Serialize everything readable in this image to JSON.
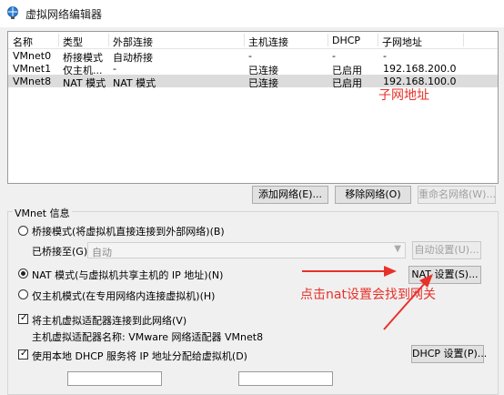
{
  "window": {
    "title": "虚拟网络编辑器"
  },
  "table": {
    "columns": [
      "名称",
      "类型",
      "外部连接",
      "主机连接",
      "DHCP",
      "子网地址"
    ],
    "rows": [
      [
        "VMnet0",
        "桥接模式",
        "自动桥接",
        "-",
        "-",
        "-"
      ],
      [
        "VMnet1",
        "仅主机...",
        "-",
        "已连接",
        "已启用",
        "192.168.200.0"
      ],
      [
        "VMnet8",
        "NAT 模式",
        "NAT 模式",
        "已连接",
        "已启用",
        "192.168.100.0"
      ]
    ],
    "selected_row": 2
  },
  "buttons": {
    "add_network": "添加网络(E)...",
    "remove_network": "移除网络(O)",
    "rename_network": "重命名网络(W)...",
    "auto_settings": "自动设置(U)...",
    "nat_settings": "NAT 设置(S)...",
    "dhcp_settings": "DHCP 设置(P)..."
  },
  "vmnet_info": {
    "group_label": "VMnet 信息",
    "bridge_mode": "桥接模式(将虚拟机直接连接到外部网络)(B)",
    "bridged_to_label": "已桥接至(G):",
    "bridged_to_value": "自动",
    "nat_mode": "NAT 模式(与虚拟机共享主机的 IP 地址)(N)",
    "host_only_mode": "仅主机模式(在专用网络内连接虚拟机)(H)",
    "selected_mode": "nat",
    "connect_adapter": "将主机虚拟适配器连接到此网络(V)",
    "connect_adapter_checked": true,
    "adapter_name": "主机虚拟适配器名称: VMware 网络适配器 VMnet8",
    "use_dhcp": "使用本地 DHCP 服务将 IP 地址分配给虚拟机(D)",
    "use_dhcp_checked": true
  },
  "annotations": {
    "subnet_note": "子网地址",
    "nat_note": "点击nat设置会找到网关",
    "color": "#e8312a"
  },
  "colors": {
    "window_bg": "#f0f0f0",
    "selected_row": "#dcdcdc",
    "accent": "#0078d7"
  }
}
